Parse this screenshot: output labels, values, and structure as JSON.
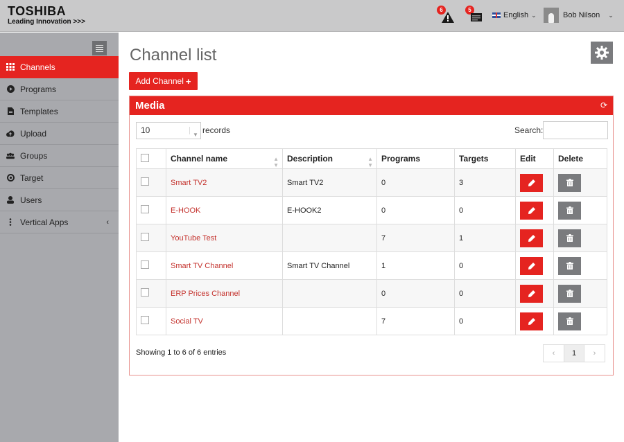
{
  "brand": {
    "name": "TOSHIBA",
    "tagline": "Leading Innovation >>>"
  },
  "topbar": {
    "alerts_count": "6",
    "messages_count": "5",
    "language": "English",
    "user_name": "Bob Nilson"
  },
  "sidebar": {
    "items": [
      {
        "label": "Channels",
        "icon": "grid-icon",
        "active": true
      },
      {
        "label": "Programs",
        "icon": "play-circle-icon"
      },
      {
        "label": "Templates",
        "icon": "file-icon"
      },
      {
        "label": "Upload",
        "icon": "cloud-upload-icon"
      },
      {
        "label": "Groups",
        "icon": "users-icon"
      },
      {
        "label": "Target",
        "icon": "target-icon"
      },
      {
        "label": "Users",
        "icon": "user-icon"
      },
      {
        "label": "Vertical Apps",
        "icon": "vertical-ellipsis-icon"
      }
    ]
  },
  "page": {
    "title": "Channel list",
    "add_button": "Add Channel"
  },
  "panel": {
    "title": "Media",
    "page_length": "10",
    "records_label": "records",
    "search_label": "Search:",
    "columns": [
      "Channel name",
      "Description",
      "Programs",
      "Targets",
      "Edit",
      "Delete"
    ],
    "rows": [
      {
        "name": "Smart TV2",
        "description": "Smart TV2",
        "programs": "0",
        "targets": "3"
      },
      {
        "name": "E-HOOK",
        "description": "E-HOOK2",
        "programs": "0",
        "targets": "0"
      },
      {
        "name": "YouTube Test",
        "description": "",
        "programs": "7",
        "targets": "1"
      },
      {
        "name": "Smart TV Channel",
        "description": "Smart TV Channel",
        "programs": "1",
        "targets": "0"
      },
      {
        "name": "ERP Prices Channel",
        "description": "",
        "programs": "0",
        "targets": "0"
      },
      {
        "name": "Social TV",
        "description": "",
        "programs": "7",
        "targets": "0"
      }
    ],
    "info": "Showing 1 to 6 of 6 entries",
    "pagination": {
      "prev": "‹",
      "current": "1",
      "next": "›"
    }
  },
  "colors": {
    "accent": "#e52420",
    "sidebar": "#a8a9ad",
    "topbar": "#c9c9ca",
    "link": "#c4322d"
  }
}
